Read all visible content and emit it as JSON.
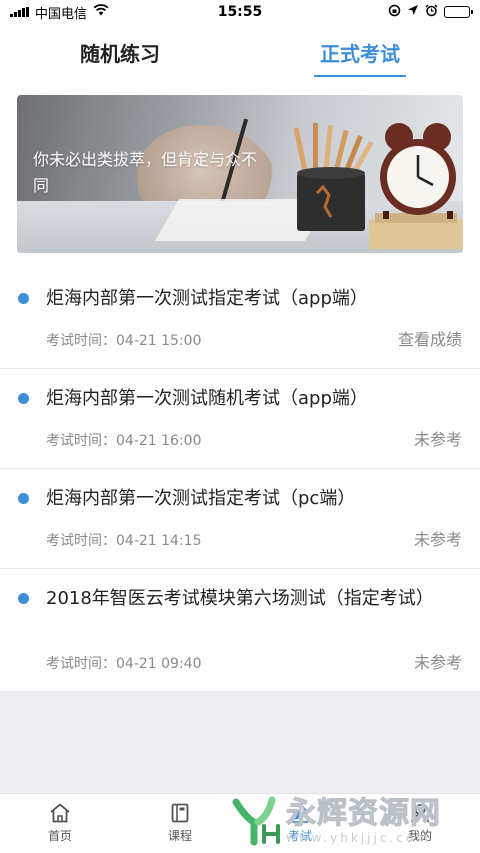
{
  "status_bar": {
    "carrier": "中国电信",
    "time": "15:55",
    "battery_level": 0.2
  },
  "tabs": [
    {
      "label": "随机练习",
      "active": false
    },
    {
      "label": "正式考试",
      "active": true
    }
  ],
  "banner": {
    "text": "你未必出类拔萃，但肯定与众不同"
  },
  "exams": [
    {
      "title": "炬海内部第一次测试指定考试（app端）",
      "time_label": "考试时间：",
      "time": "04-21 15:00",
      "status": "查看成绩"
    },
    {
      "title": "炬海内部第一次测试随机考试（app端）",
      "time_label": "考试时间：",
      "time": "04-21 16:00",
      "status": "未参考"
    },
    {
      "title": "炬海内部第一次测试指定考试（pc端）",
      "time_label": "考试时间：",
      "time": "04-21 14:15",
      "status": "未参考"
    },
    {
      "title": "2018年智医云考试模块第六场测试（指定考试）",
      "time_label": "考试时间：",
      "time": "04-21 09:40",
      "status": "未参考"
    }
  ],
  "bottom_nav": [
    {
      "label": "首页",
      "icon": "home-icon",
      "active": false
    },
    {
      "label": "课程",
      "icon": "book-icon",
      "active": false
    },
    {
      "label": "考试",
      "icon": "exam-icon",
      "active": true
    },
    {
      "label": "我的",
      "icon": "profile-icon",
      "active": false
    }
  ],
  "watermark": {
    "name": "永辉资源网",
    "url": "www.yhkjjjc.com"
  },
  "colors": {
    "accent": "#3f8fd8",
    "background_grey": "#efeff3",
    "muted_text": "#8a8a8a"
  }
}
